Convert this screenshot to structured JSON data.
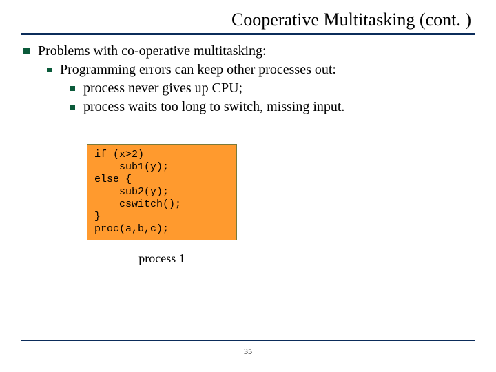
{
  "title": "Cooperative Multitasking (cont. )",
  "bullets": {
    "l1": "Problems with co-operative multitasking:",
    "l2": "Programming errors can keep other processes out:",
    "l3a": "process never gives up CPU;",
    "l3b": "process waits too long to switch, missing input."
  },
  "code": "if (x>2)\n    sub1(y);\nelse {\n    sub2(y);\n    cswitch();\n}\nproc(a,b,c);",
  "code_caption": "process 1",
  "page_number": "35"
}
